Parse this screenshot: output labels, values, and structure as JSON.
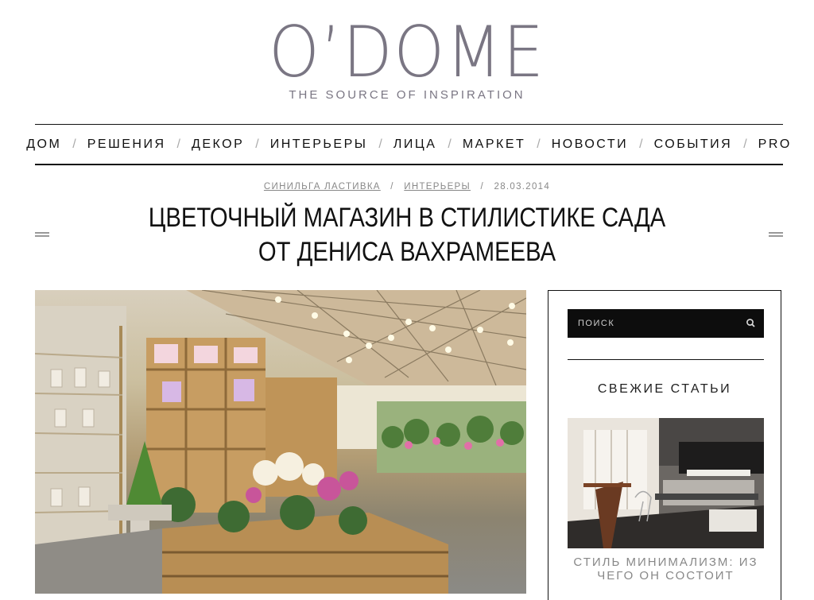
{
  "site": {
    "logo": "O’DOME",
    "tagline": "THE SOURCE OF INSPIRATION"
  },
  "nav": {
    "items": [
      "ДОМ",
      "РЕШЕНИЯ",
      "ДЕКОР",
      "ИНТЕРЬЕРЫ",
      "ЛИЦА",
      "МАРКЕТ",
      "НОВОСТИ",
      "СОБЫТИЯ",
      "PRO"
    ],
    "separator": "/"
  },
  "article": {
    "author": "СИНИЛЬГА ЛАСТИВКА",
    "category": "ИНТЕРЬЕРЫ",
    "date": "28.03.2014",
    "meta_separator": "/",
    "title": "ЦВЕТОЧНЫЙ МАГАЗИН В СТИЛИСТИКЕ САДА ОТ ДЕНИСА ВАХРАМЕЕВА"
  },
  "sidebar": {
    "search_placeholder": "поиск",
    "search_icon": "search-icon",
    "widget_title": "СВЕЖИЕ СТАТЬИ",
    "post_title": "СТИЛЬ МИНИМАЛИЗМ: ИЗ ЧЕГО ОН СОСТОИТ"
  },
  "colors": {
    "logo": "#7a7683",
    "text": "#111111",
    "muted": "#888888",
    "search_bg": "#0d0d0d"
  }
}
